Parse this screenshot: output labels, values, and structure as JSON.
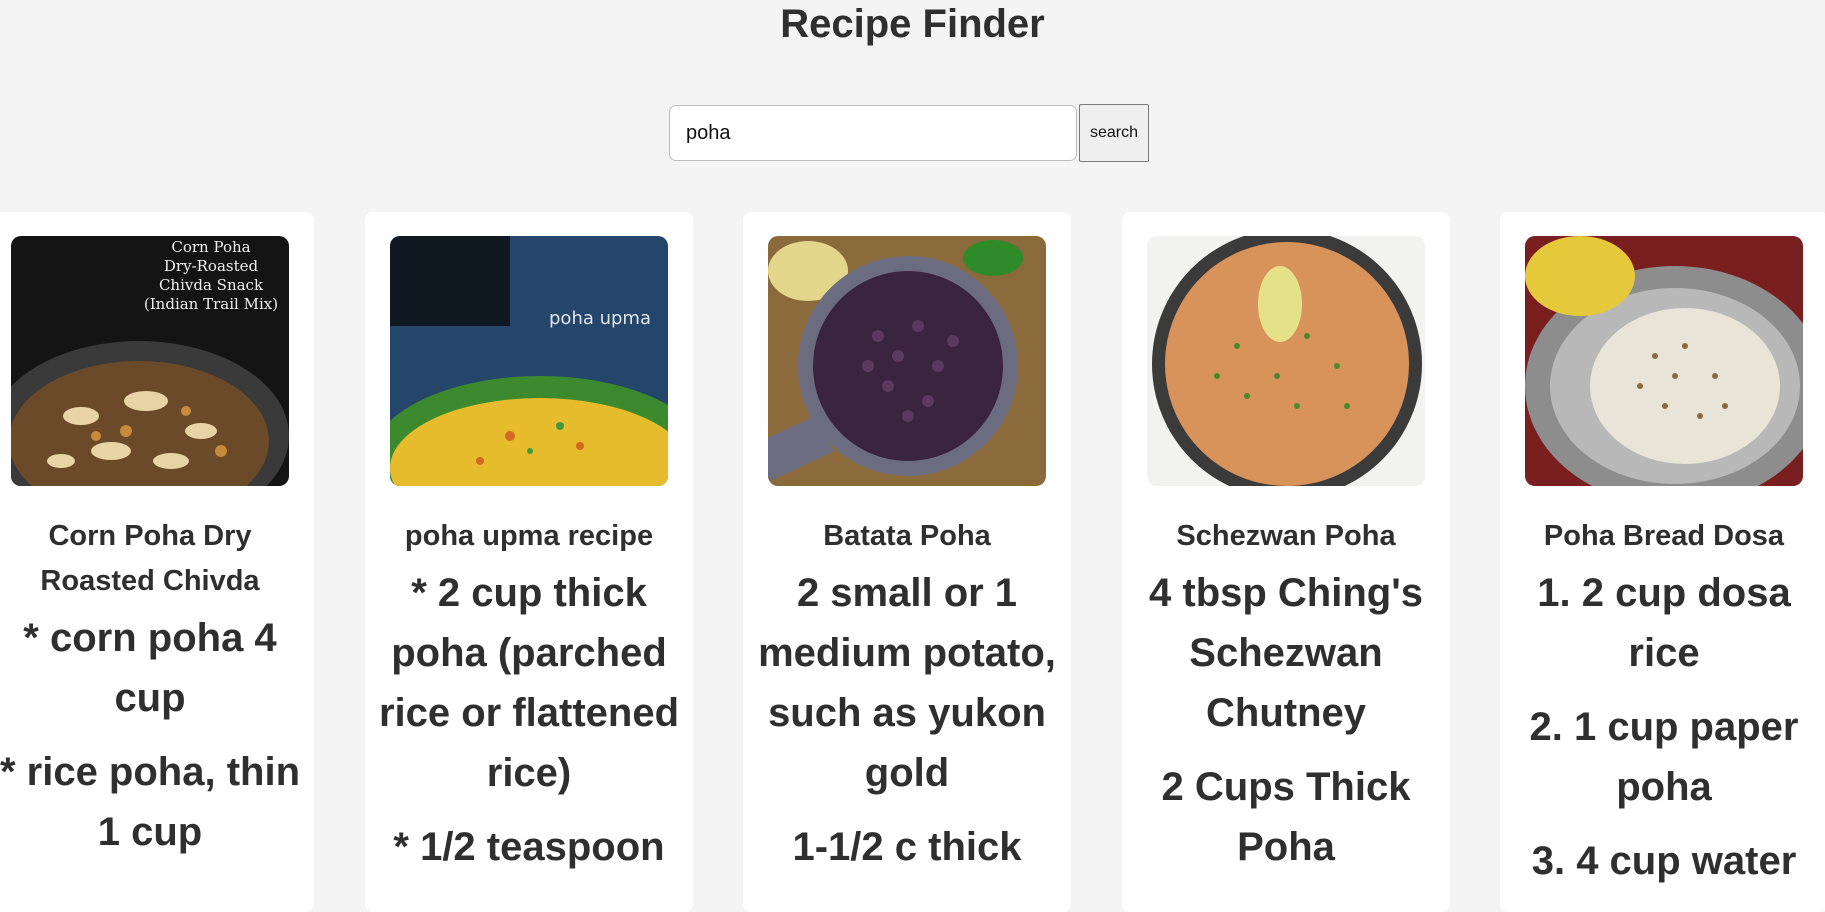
{
  "header": {
    "title": "Recipe Finder"
  },
  "search": {
    "value": "poha",
    "placeholder": "",
    "button_label": "search"
  },
  "recipes": [
    {
      "title": "Corn Poha Dry Roasted Chivda",
      "image_icon": "corn-poha-chivda-image",
      "image_caption": [
        "Corn Poha",
        "Dry-Roasted",
        "Chivda Snack",
        "(Indian Trail Mix)"
      ],
      "ingredients": [
        "* corn poha 4 cup",
        "* rice poha, thin 1 cup"
      ]
    },
    {
      "title": "poha upma recipe",
      "image_icon": "poha-upma-image",
      "image_caption": [
        "poha upma"
      ],
      "ingredients": [
        "* 2 cup thick poha (parched rice or flattened rice)",
        "* 1/2 teaspoon"
      ]
    },
    {
      "title": "Batata Poha",
      "image_icon": "batata-poha-image",
      "image_caption": [],
      "ingredients": [
        "2 small or 1 medium potato, such as yukon gold",
        "1-1/2 c thick"
      ]
    },
    {
      "title": "Schezwan Poha",
      "image_icon": "schezwan-poha-image",
      "image_caption": [],
      "ingredients": [
        "4 tbsp Ching's Schezwan Chutney",
        "2 Cups Thick Poha"
      ]
    },
    {
      "title": "Poha Bread Dosa",
      "image_icon": "poha-bread-dosa-image",
      "image_caption": [],
      "ingredients": [
        "1. 2 cup dosa rice",
        "2. 1 cup paper poha",
        "3. 4 cup water"
      ]
    }
  ]
}
